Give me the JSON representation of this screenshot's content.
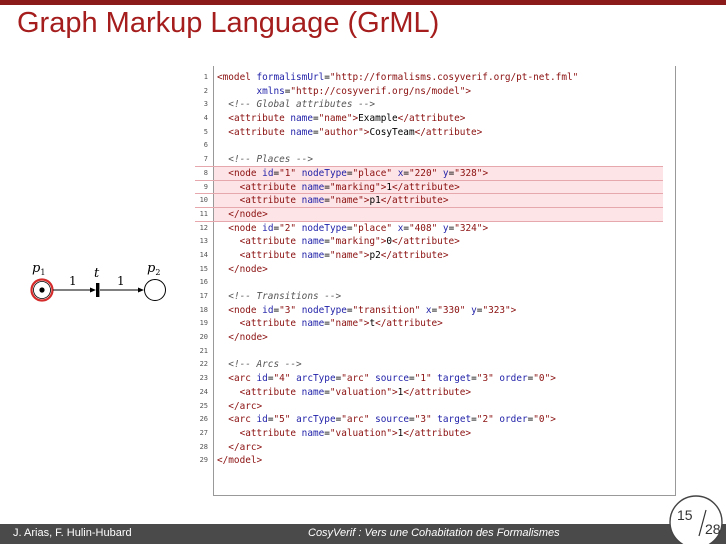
{
  "slide": {
    "title": "Graph Markup Language (GrML)",
    "footer_authors": "J. Arias, F. Hulin-Hubard",
    "footer_title": "CosyVerif : Vers une Cohabitation des Formalismes",
    "page_current": "15",
    "page_total": "28"
  },
  "net": {
    "place1_label": "p",
    "place1_sub": "1",
    "place2_label": "p",
    "place2_sub": "2",
    "transition_label": "t",
    "arc1_weight": "1",
    "arc2_weight": "1"
  },
  "code": {
    "highlighted_lines": [
      8,
      9,
      10,
      11
    ],
    "lines": [
      [
        {
          "c": "tag",
          "t": "<model "
        },
        {
          "c": "att",
          "t": "formalismUrl"
        },
        {
          "c": "",
          "t": "="
        },
        {
          "c": "val",
          "t": "\"http://formalisms.cosyverif.org/pt-net.fml\""
        }
      ],
      [
        {
          "c": "",
          "t": "       "
        },
        {
          "c": "att",
          "t": "xmlns"
        },
        {
          "c": "",
          "t": "="
        },
        {
          "c": "val",
          "t": "\"http://cosyverif.org/ns/model\""
        },
        {
          "c": "tag",
          "t": ">"
        }
      ],
      [
        {
          "c": "",
          "t": "  "
        },
        {
          "c": "cmt",
          "t": "<!-- Global attributes -->"
        }
      ],
      [
        {
          "c": "",
          "t": "  "
        },
        {
          "c": "tag",
          "t": "<attribute "
        },
        {
          "c": "att",
          "t": "name"
        },
        {
          "c": "",
          "t": "="
        },
        {
          "c": "val",
          "t": "\"name\""
        },
        {
          "c": "tag",
          "t": ">"
        },
        {
          "c": "",
          "t": "Example"
        },
        {
          "c": "tag",
          "t": "</attribute>"
        }
      ],
      [
        {
          "c": "",
          "t": "  "
        },
        {
          "c": "tag",
          "t": "<attribute "
        },
        {
          "c": "att",
          "t": "name"
        },
        {
          "c": "",
          "t": "="
        },
        {
          "c": "val",
          "t": "\"author\""
        },
        {
          "c": "tag",
          "t": ">"
        },
        {
          "c": "",
          "t": "CosyTeam"
        },
        {
          "c": "tag",
          "t": "</attribute>"
        }
      ],
      [],
      [
        {
          "c": "",
          "t": "  "
        },
        {
          "c": "cmt",
          "t": "<!-- Places -->"
        }
      ],
      [
        {
          "c": "",
          "t": "  "
        },
        {
          "c": "tag",
          "t": "<node "
        },
        {
          "c": "att",
          "t": "id"
        },
        {
          "c": "",
          "t": "="
        },
        {
          "c": "val",
          "t": "\"1\""
        },
        {
          "c": "",
          "t": " "
        },
        {
          "c": "att",
          "t": "nodeType"
        },
        {
          "c": "",
          "t": "="
        },
        {
          "c": "val",
          "t": "\"place\""
        },
        {
          "c": "",
          "t": " "
        },
        {
          "c": "att",
          "t": "x"
        },
        {
          "c": "",
          "t": "="
        },
        {
          "c": "val",
          "t": "\"220\""
        },
        {
          "c": "",
          "t": " "
        },
        {
          "c": "att",
          "t": "y"
        },
        {
          "c": "",
          "t": "="
        },
        {
          "c": "val",
          "t": "\"328\""
        },
        {
          "c": "tag",
          "t": ">"
        }
      ],
      [
        {
          "c": "",
          "t": "    "
        },
        {
          "c": "tag",
          "t": "<attribute "
        },
        {
          "c": "att",
          "t": "name"
        },
        {
          "c": "",
          "t": "="
        },
        {
          "c": "val",
          "t": "\"marking\""
        },
        {
          "c": "tag",
          "t": ">"
        },
        {
          "c": "",
          "t": "1"
        },
        {
          "c": "tag",
          "t": "</attribute>"
        }
      ],
      [
        {
          "c": "",
          "t": "    "
        },
        {
          "c": "tag",
          "t": "<attribute "
        },
        {
          "c": "att",
          "t": "name"
        },
        {
          "c": "",
          "t": "="
        },
        {
          "c": "val",
          "t": "\"name\""
        },
        {
          "c": "tag",
          "t": ">"
        },
        {
          "c": "",
          "t": "p1"
        },
        {
          "c": "tag",
          "t": "</attribute>"
        }
      ],
      [
        {
          "c": "",
          "t": "  "
        },
        {
          "c": "tag",
          "t": "</node>"
        }
      ],
      [
        {
          "c": "",
          "t": "  "
        },
        {
          "c": "tag",
          "t": "<node "
        },
        {
          "c": "att",
          "t": "id"
        },
        {
          "c": "",
          "t": "="
        },
        {
          "c": "val",
          "t": "\"2\""
        },
        {
          "c": "",
          "t": " "
        },
        {
          "c": "att",
          "t": "nodeType"
        },
        {
          "c": "",
          "t": "="
        },
        {
          "c": "val",
          "t": "\"place\""
        },
        {
          "c": "",
          "t": " "
        },
        {
          "c": "att",
          "t": "x"
        },
        {
          "c": "",
          "t": "="
        },
        {
          "c": "val",
          "t": "\"408\""
        },
        {
          "c": "",
          "t": " "
        },
        {
          "c": "att",
          "t": "y"
        },
        {
          "c": "",
          "t": "="
        },
        {
          "c": "val",
          "t": "\"324\""
        },
        {
          "c": "tag",
          "t": ">"
        }
      ],
      [
        {
          "c": "",
          "t": "    "
        },
        {
          "c": "tag",
          "t": "<attribute "
        },
        {
          "c": "att",
          "t": "name"
        },
        {
          "c": "",
          "t": "="
        },
        {
          "c": "val",
          "t": "\"marking\""
        },
        {
          "c": "tag",
          "t": ">"
        },
        {
          "c": "",
          "t": "0"
        },
        {
          "c": "tag",
          "t": "</attribute>"
        }
      ],
      [
        {
          "c": "",
          "t": "    "
        },
        {
          "c": "tag",
          "t": "<attribute "
        },
        {
          "c": "att",
          "t": "name"
        },
        {
          "c": "",
          "t": "="
        },
        {
          "c": "val",
          "t": "\"name\""
        },
        {
          "c": "tag",
          "t": ">"
        },
        {
          "c": "",
          "t": "p2"
        },
        {
          "c": "tag",
          "t": "</attribute>"
        }
      ],
      [
        {
          "c": "",
          "t": "  "
        },
        {
          "c": "tag",
          "t": "</node>"
        }
      ],
      [],
      [
        {
          "c": "",
          "t": "  "
        },
        {
          "c": "cmt",
          "t": "<!-- Transitions -->"
        }
      ],
      [
        {
          "c": "",
          "t": "  "
        },
        {
          "c": "tag",
          "t": "<node "
        },
        {
          "c": "att",
          "t": "id"
        },
        {
          "c": "",
          "t": "="
        },
        {
          "c": "val",
          "t": "\"3\""
        },
        {
          "c": "",
          "t": " "
        },
        {
          "c": "att",
          "t": "nodeType"
        },
        {
          "c": "",
          "t": "="
        },
        {
          "c": "val",
          "t": "\"transition\""
        },
        {
          "c": "",
          "t": " "
        },
        {
          "c": "att",
          "t": "x"
        },
        {
          "c": "",
          "t": "="
        },
        {
          "c": "val",
          "t": "\"330\""
        },
        {
          "c": "",
          "t": " "
        },
        {
          "c": "att",
          "t": "y"
        },
        {
          "c": "",
          "t": "="
        },
        {
          "c": "val",
          "t": "\"323\""
        },
        {
          "c": "tag",
          "t": ">"
        }
      ],
      [
        {
          "c": "",
          "t": "    "
        },
        {
          "c": "tag",
          "t": "<attribute "
        },
        {
          "c": "att",
          "t": "name"
        },
        {
          "c": "",
          "t": "="
        },
        {
          "c": "val",
          "t": "\"name\""
        },
        {
          "c": "tag",
          "t": ">"
        },
        {
          "c": "",
          "t": "t"
        },
        {
          "c": "tag",
          "t": "</attribute>"
        }
      ],
      [
        {
          "c": "",
          "t": "  "
        },
        {
          "c": "tag",
          "t": "</node>"
        }
      ],
      [],
      [
        {
          "c": "",
          "t": "  "
        },
        {
          "c": "cmt",
          "t": "<!-- Arcs -->"
        }
      ],
      [
        {
          "c": "",
          "t": "  "
        },
        {
          "c": "tag",
          "t": "<arc "
        },
        {
          "c": "att",
          "t": "id"
        },
        {
          "c": "",
          "t": "="
        },
        {
          "c": "val",
          "t": "\"4\""
        },
        {
          "c": "",
          "t": " "
        },
        {
          "c": "att",
          "t": "arcType"
        },
        {
          "c": "",
          "t": "="
        },
        {
          "c": "val",
          "t": "\"arc\""
        },
        {
          "c": "",
          "t": " "
        },
        {
          "c": "att",
          "t": "source"
        },
        {
          "c": "",
          "t": "="
        },
        {
          "c": "val",
          "t": "\"1\""
        },
        {
          "c": "",
          "t": " "
        },
        {
          "c": "att",
          "t": "target"
        },
        {
          "c": "",
          "t": "="
        },
        {
          "c": "val",
          "t": "\"3\""
        },
        {
          "c": "",
          "t": " "
        },
        {
          "c": "att",
          "t": "order"
        },
        {
          "c": "",
          "t": "="
        },
        {
          "c": "val",
          "t": "\"0\""
        },
        {
          "c": "tag",
          "t": ">"
        }
      ],
      [
        {
          "c": "",
          "t": "    "
        },
        {
          "c": "tag",
          "t": "<attribute "
        },
        {
          "c": "att",
          "t": "name"
        },
        {
          "c": "",
          "t": "="
        },
        {
          "c": "val",
          "t": "\"valuation\""
        },
        {
          "c": "tag",
          "t": ">"
        },
        {
          "c": "",
          "t": "1"
        },
        {
          "c": "tag",
          "t": "</attribute>"
        }
      ],
      [
        {
          "c": "",
          "t": "  "
        },
        {
          "c": "tag",
          "t": "</arc>"
        }
      ],
      [
        {
          "c": "",
          "t": "  "
        },
        {
          "c": "tag",
          "t": "<arc "
        },
        {
          "c": "att",
          "t": "id"
        },
        {
          "c": "",
          "t": "="
        },
        {
          "c": "val",
          "t": "\"5\""
        },
        {
          "c": "",
          "t": " "
        },
        {
          "c": "att",
          "t": "arcType"
        },
        {
          "c": "",
          "t": "="
        },
        {
          "c": "val",
          "t": "\"arc\""
        },
        {
          "c": "",
          "t": " "
        },
        {
          "c": "att",
          "t": "source"
        },
        {
          "c": "",
          "t": "="
        },
        {
          "c": "val",
          "t": "\"3\""
        },
        {
          "c": "",
          "t": " "
        },
        {
          "c": "att",
          "t": "target"
        },
        {
          "c": "",
          "t": "="
        },
        {
          "c": "val",
          "t": "\"2\""
        },
        {
          "c": "",
          "t": " "
        },
        {
          "c": "att",
          "t": "order"
        },
        {
          "c": "",
          "t": "="
        },
        {
          "c": "val",
          "t": "\"0\""
        },
        {
          "c": "tag",
          "t": ">"
        }
      ],
      [
        {
          "c": "",
          "t": "    "
        },
        {
          "c": "tag",
          "t": "<attribute "
        },
        {
          "c": "att",
          "t": "name"
        },
        {
          "c": "",
          "t": "="
        },
        {
          "c": "val",
          "t": "\"valuation\""
        },
        {
          "c": "tag",
          "t": ">"
        },
        {
          "c": "",
          "t": "1"
        },
        {
          "c": "tag",
          "t": "</attribute>"
        }
      ],
      [
        {
          "c": "",
          "t": "  "
        },
        {
          "c": "tag",
          "t": "</arc>"
        }
      ],
      [
        {
          "c": "tag",
          "t": "</model>"
        }
      ]
    ]
  },
  "colors": {
    "title": "#a51d1d",
    "highlight": "#fde4e6",
    "token_ring": "#d42b2b"
  }
}
